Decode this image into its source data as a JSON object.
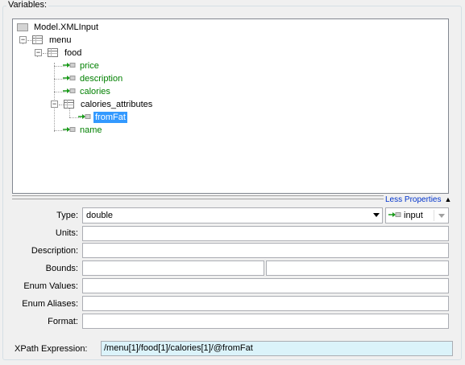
{
  "group": {
    "title": "Variables:"
  },
  "tree": {
    "root": "Model.XMLInput",
    "menu": "menu",
    "food": "food",
    "price": "price",
    "description": "description",
    "calories": "calories",
    "calories_attributes": "calories_attributes",
    "fromFat": "fromFat",
    "name": "name"
  },
  "properties_toggle": "Less Properties",
  "form": {
    "type_label": "Type:",
    "type_value": "double",
    "direction_value": "input",
    "units_label": "Units:",
    "units_value": "",
    "description_label": "Description:",
    "description_value": "",
    "bounds_label": "Bounds:",
    "bounds_min": "",
    "bounds_max": "",
    "enum_values_label": "Enum Values:",
    "enum_values_value": "",
    "enum_aliases_label": "Enum Aliases:",
    "enum_aliases_value": "",
    "format_label": "Format:",
    "format_value": "",
    "xpath_label": "XPath Expression:",
    "xpath_value": "/menu[1]/food[1]/calories[1]/@fromFat"
  },
  "colors": {
    "leaf_text": "#008000",
    "selection": "#3399ff",
    "link": "#0033cc",
    "xpath_bg": "#dbf3fa"
  }
}
